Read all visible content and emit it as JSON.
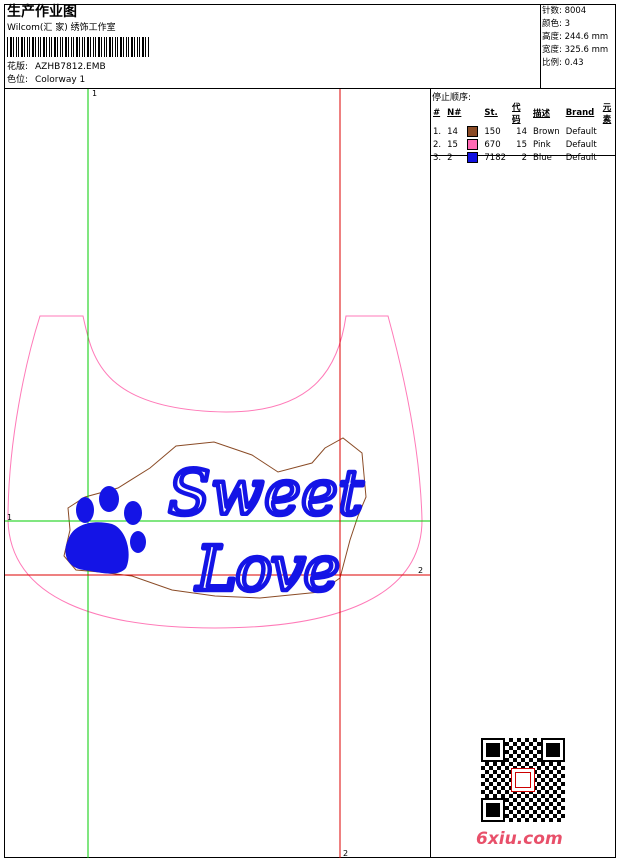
{
  "header": {
    "title": "生产作业图",
    "subtitle": "Wilcom(汇 家) 绣饰工作室",
    "design_label": "花版:",
    "design_value": "AZHB7812.EMB",
    "colorway_label": "色位:",
    "colorway_value": "Colorway 1"
  },
  "stats": [
    {
      "label": "针数:",
      "value": "8004"
    },
    {
      "label": "颜色:",
      "value": "3"
    },
    {
      "label": "高度:",
      "value": "244.6 mm"
    },
    {
      "label": "宽度:",
      "value": "325.6 mm"
    },
    {
      "label": "比例:",
      "value": "0.43"
    }
  ],
  "stop_sequence": {
    "title": "停止顺序:",
    "columns": [
      "#",
      "N#",
      "St.",
      "代码",
      "描述",
      "Brand",
      "元素"
    ],
    "rows": [
      {
        "idx": "1.",
        "n": "14",
        "color": "#8a4b26",
        "st": "150",
        "code": "14",
        "desc": "Brown",
        "brand": "Default"
      },
      {
        "idx": "2.",
        "n": "15",
        "color": "#ff69b4",
        "st": "670",
        "code": "15",
        "desc": "Pink",
        "brand": "Default"
      },
      {
        "idx": "3.",
        "n": "2",
        "color": "#1010e0",
        "st": "7182",
        "code": "2",
        "desc": "Blue",
        "brand": "Default"
      }
    ]
  },
  "guides": {
    "green_label_top": "1",
    "green_label_left": "1",
    "red_label_right": "2",
    "red_label_bottom": "2"
  },
  "design": {
    "text_line1": "Sweet",
    "text_line2": "Love"
  },
  "watermark": {
    "logo_text": "6xiu.com"
  },
  "colors": {
    "outline_pink": "#ff7ab8",
    "applique_brown": "#8a4b26",
    "stitch_blue": "#1414e6",
    "guide_green": "#00cc00",
    "guide_red": "#dd0000"
  }
}
